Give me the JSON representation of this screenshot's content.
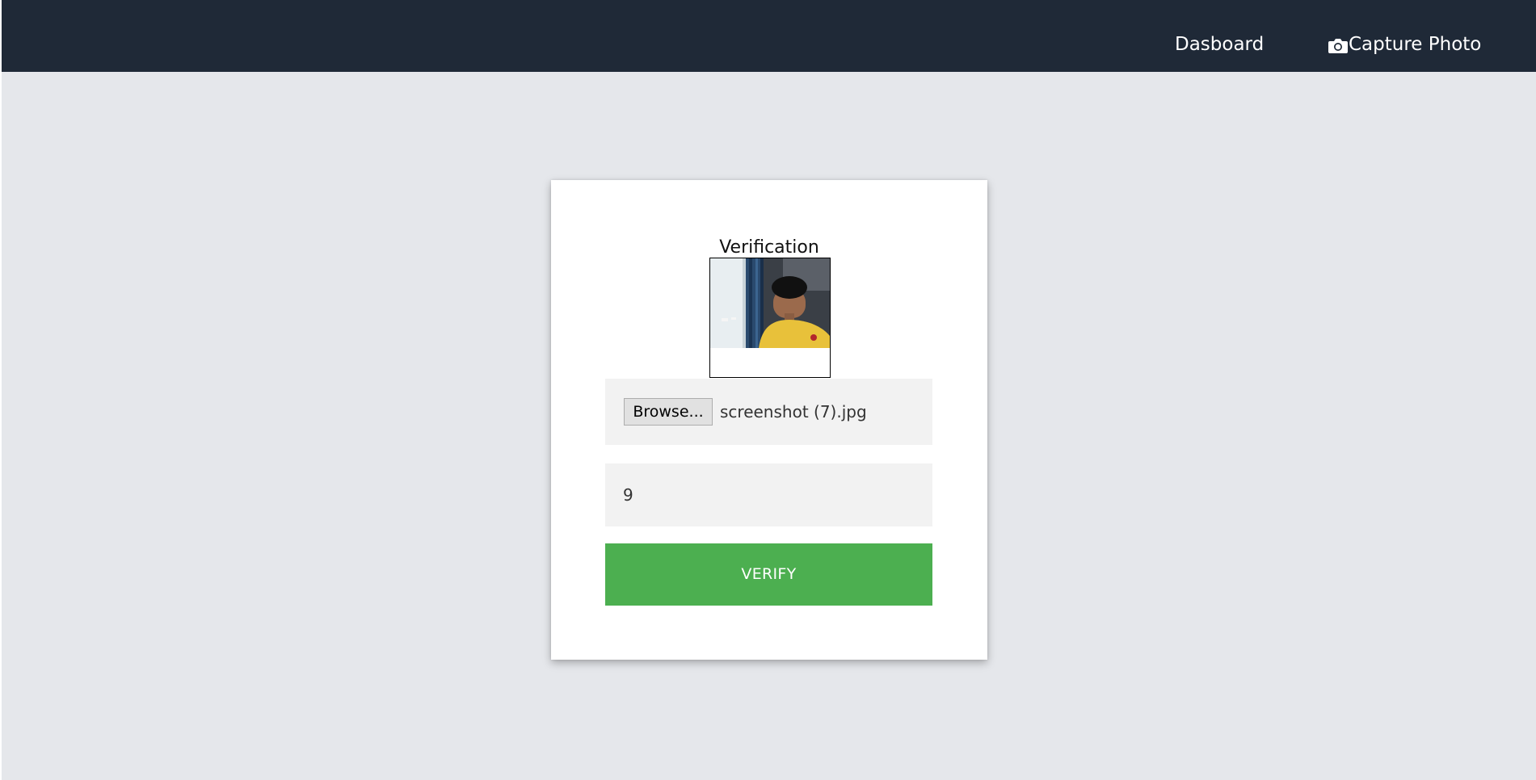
{
  "colors": {
    "navbar_bg": "#1f2937",
    "page_bg": "#e5e7eb",
    "card_bg": "#ffffff",
    "field_bg": "#f2f2f2",
    "verify_bg": "#4caf50",
    "nav_text": "#ffffff"
  },
  "navbar": {
    "links": [
      {
        "label": "Dasboard",
        "icon": null
      },
      {
        "label": "Capture Photo",
        "icon": "camera-icon"
      }
    ]
  },
  "card": {
    "title": "Verification",
    "photo": {
      "icon": "captured-photo-preview"
    },
    "file_input": {
      "button_label": "Browse...",
      "file_name": "screenshot (7).jpg"
    },
    "number_input": {
      "value": "9"
    },
    "verify_button": {
      "label": "VERIFY"
    }
  }
}
